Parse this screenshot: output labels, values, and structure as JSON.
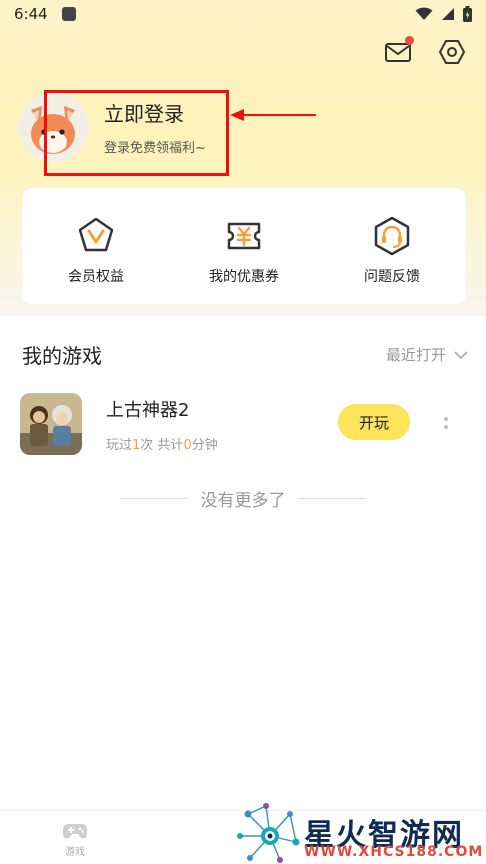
{
  "status_bar": {
    "time": "6:44"
  },
  "header": {
    "mail_icon": "mail-icon",
    "settings_icon": "settings-hex-icon",
    "has_unread": true
  },
  "profile": {
    "title": "立即登录",
    "subtitle": "登录免费领福利~"
  },
  "quick_actions": [
    {
      "label": "会员权益",
      "icon": "vip-badge-icon"
    },
    {
      "label": "我的优惠券",
      "icon": "coupon-icon"
    },
    {
      "label": "问题反馈",
      "icon": "headset-icon"
    }
  ],
  "games": {
    "title": "我的游戏",
    "sort_label": "最近打开",
    "items": [
      {
        "name": "上古神器2",
        "stats_prefix": "玩过",
        "plays": "1",
        "stats_mid": "次 共计",
        "minutes": "0",
        "stats_suffix": "分钟",
        "play_label": "开玩"
      }
    ],
    "end_text": "没有更多了"
  },
  "bottom_nav": {
    "game_label": "游戏"
  },
  "watermark": {
    "title": "星火智游网",
    "url": "WWW.XHCS188.COM"
  },
  "colors": {
    "accent_yellow": "#fbe35c",
    "highlight_orange": "#f3a23a",
    "annotation_red": "#ef0f0f"
  }
}
